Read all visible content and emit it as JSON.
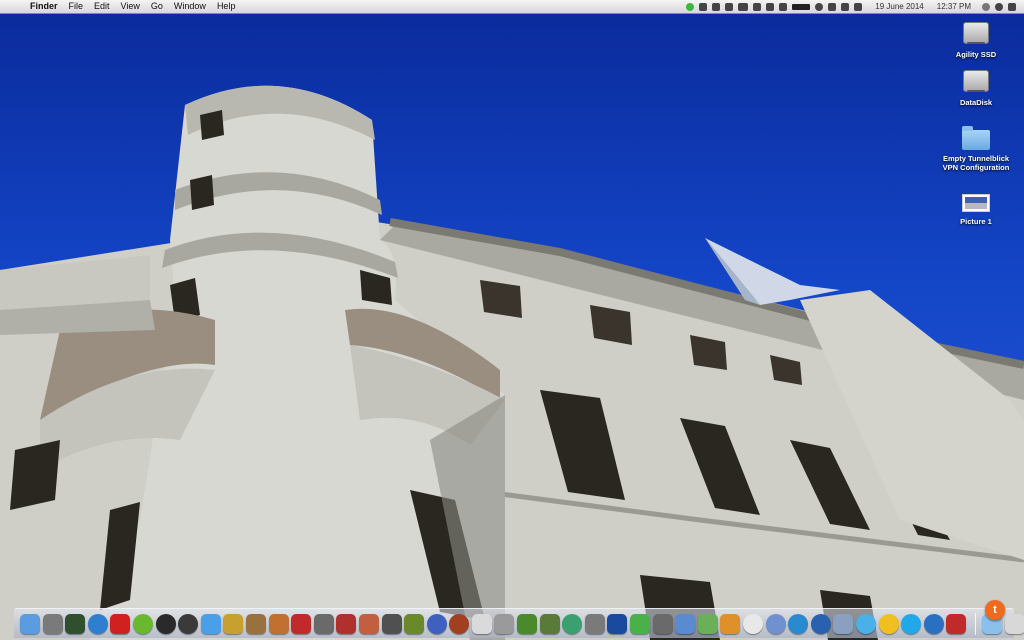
{
  "menubar": {
    "apple_glyph": "",
    "app_name": "Finder",
    "menus": [
      "File",
      "Edit",
      "View",
      "Go",
      "Window",
      "Help"
    ],
    "status_icons": [
      {
        "icon": "evernote-status-icon",
        "color": "#3fb63f"
      },
      {
        "icon": "dropbox-icon"
      },
      {
        "icon": "grid-icon"
      },
      {
        "icon": "tools-icon"
      },
      {
        "icon": "printer-icon"
      },
      {
        "icon": "clipboard-icon"
      },
      {
        "icon": "document-icon"
      },
      {
        "icon": "eject-icon"
      },
      {
        "icon": "battery-graph-icon"
      },
      {
        "icon": "time-machine-icon"
      },
      {
        "icon": "bluetooth-dots-icon"
      },
      {
        "icon": "wifi-icon"
      },
      {
        "icon": "volume-icon"
      }
    ],
    "date": "19 June 2014",
    "time": "12:37 PM",
    "trailing_icons": [
      "notification-bubble-icon",
      "user-icon",
      "list-icon"
    ]
  },
  "desktop_icons": [
    {
      "label": "Agility SSD",
      "icon": "hard-disk-icon"
    },
    {
      "label": "DataDisk",
      "icon": "hard-disk-icon"
    },
    {
      "label": "Empty Tunnelblick\nVPN Configuration",
      "icon": "folder-icon"
    },
    {
      "label": "Picture 1",
      "icon": "picture-icon"
    }
  ],
  "dock": {
    "apps": [
      {
        "icon": "finder-icon",
        "color": "#5b9be0"
      },
      {
        "icon": "launchpad-icon",
        "color": "#7a7a7a"
      },
      {
        "icon": "activity-monitor-icon",
        "color": "#2f4f2f"
      },
      {
        "icon": "safari-icon",
        "color": "#2f7fd0"
      },
      {
        "icon": "red-app-icon",
        "color": "#d02020"
      },
      {
        "icon": "spotify-icon",
        "color": "#6ab82f"
      },
      {
        "icon": "dvd-player-icon",
        "color": "#2a2a2a"
      },
      {
        "icon": "dashboard-icon",
        "color": "#3a3a3a"
      },
      {
        "icon": "app-store-icon",
        "color": "#4aa0e8"
      },
      {
        "icon": "star-app-icon",
        "color": "#c8a030"
      },
      {
        "icon": "photo-app-icon",
        "color": "#9a7040"
      },
      {
        "icon": "garageband-icon",
        "color": "#c07030"
      },
      {
        "icon": "mail-app-icon",
        "color": "#c02a2a"
      },
      {
        "icon": "disk-utility-icon",
        "color": "#6a6a6a"
      },
      {
        "icon": "x-app-icon",
        "color": "#b03030"
      },
      {
        "icon": "map-app-icon",
        "color": "#c06040"
      },
      {
        "icon": "pen-app-icon",
        "color": "#505050"
      },
      {
        "icon": "bug-app-icon",
        "color": "#6a8a2a"
      },
      {
        "icon": "globe-app-icon",
        "color": "#4060c0"
      },
      {
        "icon": "basketball-app-icon",
        "color": "#a04020"
      },
      {
        "icon": "kanji-app-icon",
        "color": "#dadada"
      },
      {
        "icon": "transmit-app-icon",
        "color": "#9a9a9a"
      },
      {
        "icon": "plant-app-icon",
        "color": "#4a8a2a"
      },
      {
        "icon": "minecraft-icon",
        "color": "#5a7a3a"
      },
      {
        "icon": "at-app-icon",
        "color": "#3aa070"
      },
      {
        "icon": "vault-app-icon",
        "color": "#7a7a7a"
      },
      {
        "icon": "photoshop-icon",
        "color": "#1a4aa0"
      },
      {
        "icon": "evernote-icon",
        "color": "#4ab04a"
      },
      {
        "icon": "elephant-app-icon",
        "color": "#6a6a6a"
      },
      {
        "icon": "cloud-app-icon",
        "color": "#5a8ad0"
      },
      {
        "icon": "leaf-app-icon",
        "color": "#6ab05a"
      },
      {
        "icon": "p-app-icon",
        "color": "#e0902a"
      },
      {
        "icon": "clock-app-icon",
        "color": "#e8e8e8"
      },
      {
        "icon": "compass-app-icon",
        "color": "#7090d0"
      },
      {
        "icon": "ubuntu-app-icon",
        "color": "#2a8ad0"
      },
      {
        "icon": "earth-app-icon",
        "color": "#2a60b0"
      },
      {
        "icon": "preview-app-icon",
        "color": "#8aa0c0"
      },
      {
        "icon": "messages-app-icon",
        "color": "#4ab0e8"
      },
      {
        "icon": "smiley-app-icon",
        "color": "#f0c020"
      },
      {
        "icon": "skype-icon",
        "color": "#20a8e8"
      },
      {
        "icon": "home-app-icon",
        "color": "#2a70c0"
      },
      {
        "icon": "utility-app-icon",
        "color": "#c02a2a"
      }
    ],
    "trailing": [
      {
        "icon": "downloads-folder-icon",
        "color": "#8ac0ea"
      },
      {
        "icon": "devices-icon",
        "color": "#d8d8d8"
      },
      {
        "icon": "monitor-icon",
        "color": "#9a9a9a"
      },
      {
        "icon": "trash-icon",
        "color": "#b8b8b8"
      }
    ],
    "badge": {
      "icon": "tumblr-badge-icon",
      "label": "t",
      "color": "#f06a1e"
    }
  }
}
